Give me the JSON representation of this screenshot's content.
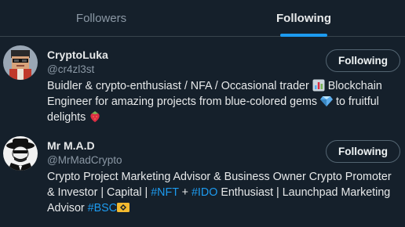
{
  "tabs": [
    {
      "label": "Followers",
      "active": false
    },
    {
      "label": "Following",
      "active": true
    }
  ],
  "users": [
    {
      "name": "CryptoLuka",
      "handle": "@cr4zl3st",
      "button": "Following",
      "bio": {
        "text1": "Buidler & crypto-enthusiast / NFA / Occasional trader ",
        "emoji1": "bar-chart-emoji",
        "text2": " Blockchain Engineer for amazing projects from blue-colored gems ",
        "emoji2": "gem-emoji",
        "text3": " to fruitful delights ",
        "emoji3": "strawberry-emoji"
      }
    },
    {
      "name": "Mr M.A.D",
      "handle": "@MrMadCrypto",
      "button": "Following",
      "bio": {
        "text1": "Crypto Project Marketing Advisor & Business Owner Crypto Promoter & Investor | Capital | ",
        "link1": "#NFT",
        "text2": " + ",
        "link2": "#IDO",
        "text3": " Enthusiast | Launchpad Marketing Advisor ",
        "link3": "#BSC",
        "emoji1": "bnb-emoji"
      }
    }
  ],
  "colors": {
    "background": "#15202b",
    "accent": "#1d9bf0",
    "muted_text": "#8b98a5",
    "border": "#38444d"
  }
}
